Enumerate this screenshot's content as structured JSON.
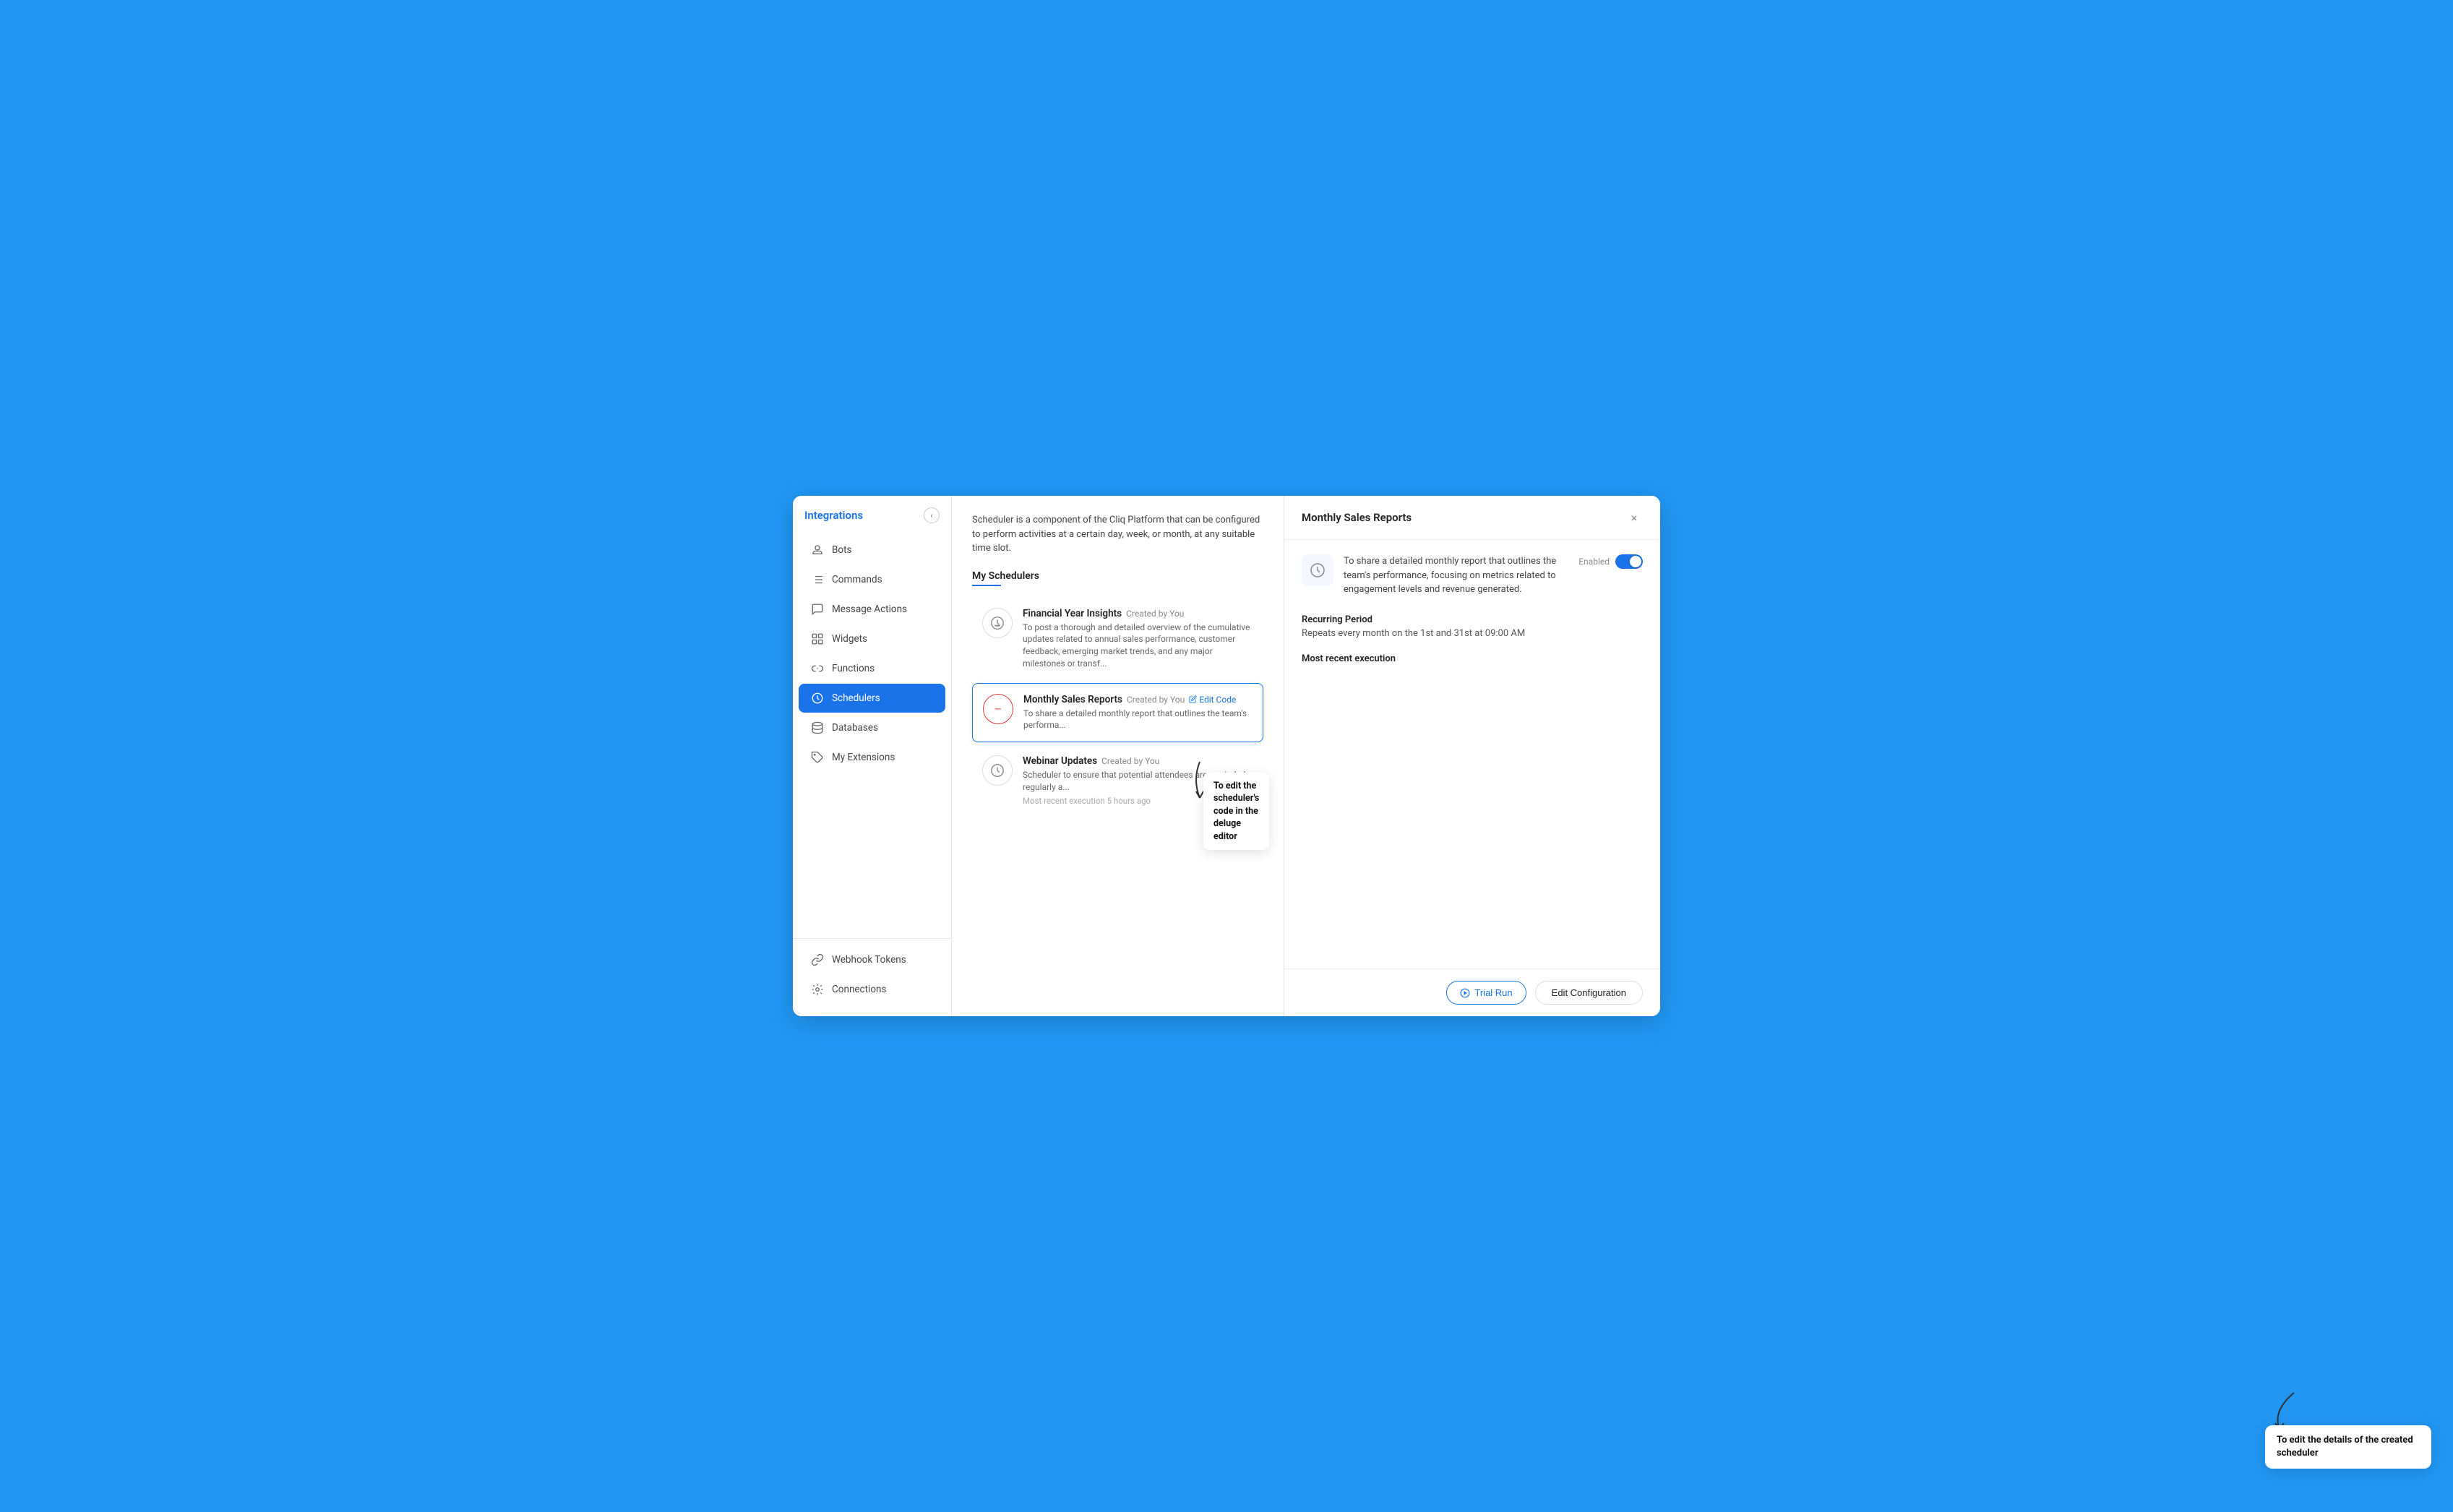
{
  "sidebar": {
    "title": "Integrations",
    "collapse_icon": "‹",
    "items": [
      {
        "id": "bots",
        "label": "Bots",
        "icon": "bot"
      },
      {
        "id": "commands",
        "label": "Commands",
        "icon": "command"
      },
      {
        "id": "message-actions",
        "label": "Message Actions",
        "icon": "message"
      },
      {
        "id": "widgets",
        "label": "Widgets",
        "icon": "widget"
      },
      {
        "id": "functions",
        "label": "Functions",
        "icon": "function"
      },
      {
        "id": "schedulers",
        "label": "Schedulers",
        "icon": "scheduler",
        "active": true
      },
      {
        "id": "databases",
        "label": "Databases",
        "icon": "database"
      },
      {
        "id": "my-extensions",
        "label": "My Extensions",
        "icon": "extension"
      }
    ],
    "footer_items": [
      {
        "id": "webhook-tokens",
        "label": "Webhook Tokens",
        "icon": "webhook"
      },
      {
        "id": "connections",
        "label": "Connections",
        "icon": "connections"
      }
    ]
  },
  "main": {
    "description": "Scheduler is a component of the Cliq Platform that can be configured to perform activities at a certain day, week, or month, at any suitable time slot.",
    "section_title": "My Schedulers",
    "schedulers": [
      {
        "id": "financial-year-insights",
        "name": "Financial Year Insights",
        "created_by": "Created by You",
        "description": "To post a thorough and detailed overview of the cumulative updates related to annual sales performance, customer feedback, emerging market trends, and any major milestones or transf...",
        "icon_type": "normal",
        "selected": false
      },
      {
        "id": "monthly-sales-reports",
        "name": "Monthly Sales Reports",
        "created_by": "Created by You",
        "description": "To share a detailed monthly report that outlines the team's performa...",
        "icon_type": "error",
        "selected": true,
        "edit_code_label": "Edit Code"
      },
      {
        "id": "webinar-updates",
        "name": "Webinar Updates",
        "created_by": "Created by You",
        "description": "Scheduler to ensure that potential attendees are reminded regularly a...",
        "meta": "Most recent execution 5 hours ago",
        "icon_type": "normal",
        "selected": false
      }
    ]
  },
  "panel": {
    "title": "Monthly Sales Reports",
    "close_icon": "×",
    "description": "To share a detailed monthly report that outlines the team's performance, focusing on metrics related to engagement levels and revenue generated.",
    "enabled_label": "Enabled",
    "recurring_period_label": "Recurring Period",
    "recurring_period_value": "Repeats every month on the 1st and 31st at 09:00 AM",
    "most_recent_label": "Most recent execution",
    "most_recent_value": "",
    "trial_run_label": "Trial Run",
    "edit_config_label": "Edit Configuration"
  },
  "annotations": {
    "edit_code": {
      "text": "To edit the scheduler's code in the deluge editor"
    },
    "edit_config": {
      "text": "To edit the details of the created scheduler"
    }
  }
}
